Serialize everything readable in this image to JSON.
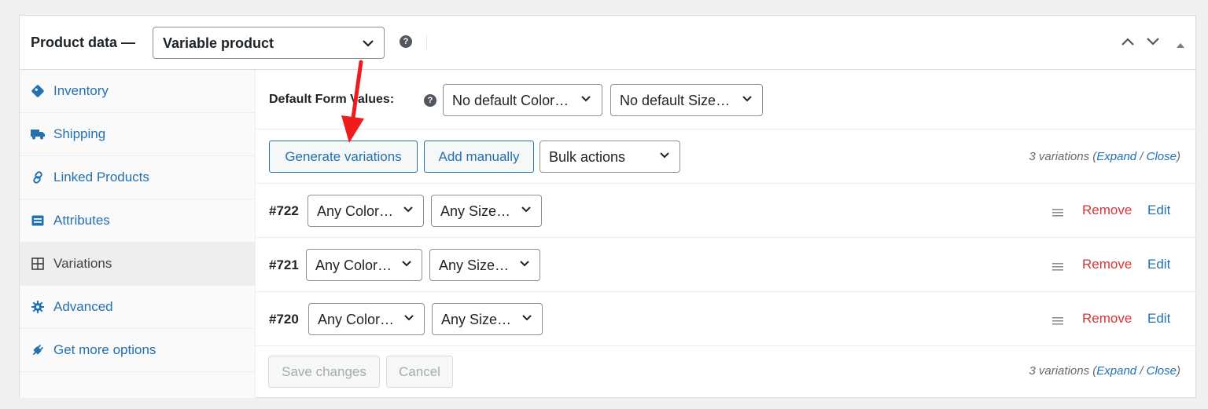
{
  "header": {
    "label": "Product data —",
    "product_type": "Variable product",
    "help": "?"
  },
  "sidebar": {
    "tabs": [
      {
        "label": "Inventory",
        "icon": "tag-icon"
      },
      {
        "label": "Shipping",
        "icon": "truck-icon"
      },
      {
        "label": "Linked Products",
        "icon": "link-icon"
      },
      {
        "label": "Attributes",
        "icon": "list-icon"
      },
      {
        "label": "Variations",
        "icon": "grid-icon",
        "active": true
      },
      {
        "label": "Advanced",
        "icon": "gear-icon"
      },
      {
        "label": "Get more options",
        "icon": "plugin-icon"
      }
    ]
  },
  "defaults": {
    "label": "Default Form Values:",
    "help": "?",
    "color_select": "No default Color…",
    "size_select": "No default Size…"
  },
  "actions": {
    "generate": "Generate variations",
    "add_manually": "Add manually",
    "bulk": "Bulk actions",
    "count_text": "3 variations (",
    "expand": "Expand",
    "slash": " / ",
    "close": "Close",
    "close_paren": ")"
  },
  "variations": [
    {
      "id": "#722",
      "color": "Any Color…",
      "size": "Any Size…",
      "remove": "Remove",
      "edit": "Edit"
    },
    {
      "id": "#721",
      "color": "Any Color…",
      "size": "Any Size…",
      "remove": "Remove",
      "edit": "Edit"
    },
    {
      "id": "#720",
      "color": "Any Color…",
      "size": "Any Size…",
      "remove": "Remove",
      "edit": "Edit"
    }
  ],
  "footer": {
    "save": "Save changes",
    "cancel": "Cancel",
    "count_text": "3 variations (",
    "expand": "Expand",
    "slash": " / ",
    "close": "Close",
    "close_paren": ")"
  },
  "colors": {
    "accent": "#2271b1",
    "danger": "#d63638",
    "annotation_arrow": "#ee1c1c"
  }
}
